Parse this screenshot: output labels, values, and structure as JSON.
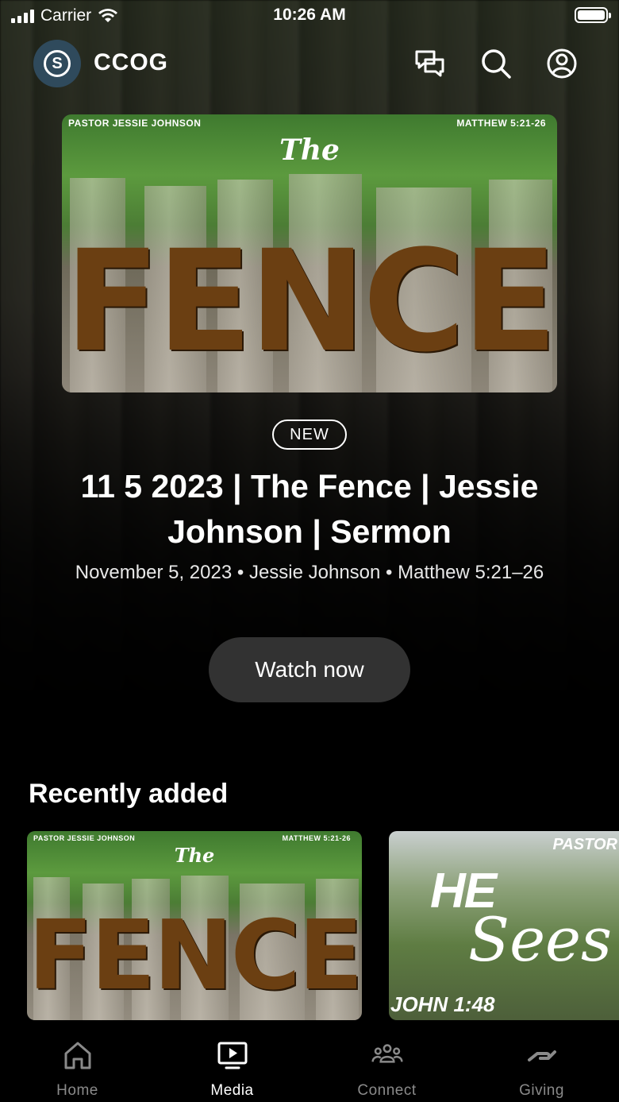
{
  "status_bar": {
    "carrier": "Carrier",
    "time": "10:26 AM"
  },
  "header": {
    "app_name": "CCOG",
    "logo_letter": "S"
  },
  "hero": {
    "art": {
      "caption_left": "PASTOR JESSIE JOHNSON",
      "caption_right": "MATTHEW 5:21-26",
      "the": "The",
      "fence": "FENCE"
    },
    "badge": "NEW",
    "title": "11 5 2023 | The Fence | Jessie Johnson | Sermon",
    "meta": "November 5, 2023 • Jessie Johnson • Matthew 5:21–26",
    "watch_label": "Watch now"
  },
  "recently_added": {
    "title": "Recently added",
    "cards": [
      {
        "caption_left": "PASTOR JESSIE JOHNSON",
        "caption_right": "MATTHEW 5:21-26",
        "the": "The",
        "fence": "FENCE"
      },
      {
        "pastor": "PASTOR",
        "he": "HE",
        "sees": "Sees",
        "ref": "JOHN 1:48"
      }
    ]
  },
  "tabs": [
    {
      "label": "Home",
      "icon": "home-icon",
      "active": false
    },
    {
      "label": "Media",
      "icon": "media-icon",
      "active": true
    },
    {
      "label": "Connect",
      "icon": "connect-icon",
      "active": false
    },
    {
      "label": "Giving",
      "icon": "giving-icon",
      "active": false
    }
  ],
  "colors": {
    "background": "#000000",
    "button": "#323232",
    "inactive_tab": "#8a8a8a",
    "logo_bg": "#2f4a5c"
  }
}
